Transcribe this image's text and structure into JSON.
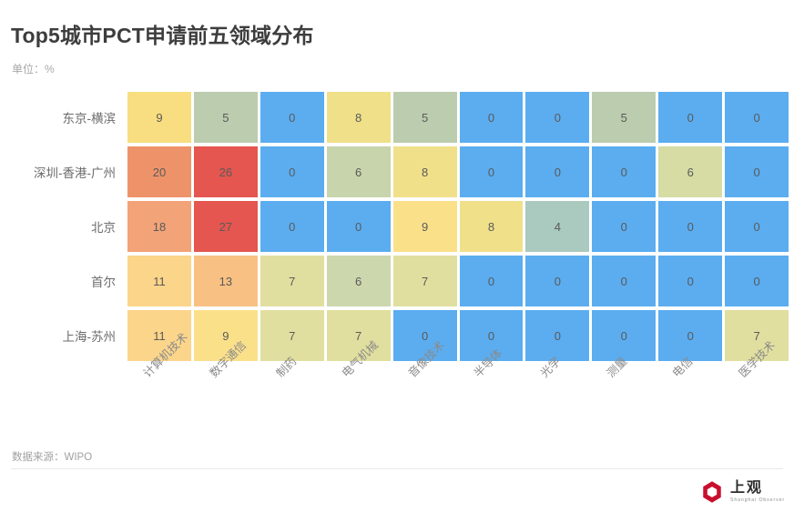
{
  "header": {
    "title": "Top5城市PCT申请前五领域分布",
    "subtitle": "单位：%"
  },
  "footer": {
    "source": "数据来源：WIPO",
    "logo_cn": "上观",
    "logo_en": "Shanghai Observer",
    "logo_color": "#C8102E"
  },
  "chart_data": {
    "type": "heatmap",
    "title": "Top5城市PCT申请前五领域分布",
    "subtitle": "单位：%",
    "xlabel": "",
    "ylabel": "",
    "unit": "%",
    "categories": [
      "计算机技术",
      "数字通信",
      "制药",
      "电气机械",
      "音像技术",
      "半导体",
      "光学",
      "测量",
      "电信",
      "医学技术"
    ],
    "rows": [
      "东京-横滨",
      "深圳-香港-广州",
      "北京",
      "首尔",
      "上海-苏州"
    ],
    "values": [
      [
        9,
        5,
        0,
        8,
        5,
        0,
        0,
        5,
        0,
        0
      ],
      [
        20,
        26,
        0,
        6,
        8,
        0,
        0,
        0,
        6,
        0
      ],
      [
        18,
        27,
        0,
        0,
        9,
        8,
        4,
        0,
        0,
        0
      ],
      [
        11,
        13,
        7,
        6,
        7,
        0,
        0,
        0,
        0,
        0
      ],
      [
        11,
        9,
        7,
        7,
        0,
        0,
        0,
        0,
        0,
        7
      ]
    ],
    "cell_colors": [
      [
        "#F8DE80",
        "#BCCCAF",
        "#5BADF0",
        "#F0E08A",
        "#BCCCAF",
        "#5BADF0",
        "#5BADF0",
        "#BCCCAF",
        "#5BADF0",
        "#5BADF0"
      ],
      [
        "#EE9369",
        "#E4564F",
        "#5BADF0",
        "#C8D4AB",
        "#F0E08A",
        "#5BADF0",
        "#5BADF0",
        "#5BADF0",
        "#D6DCA4",
        "#5BADF0"
      ],
      [
        "#F2A377",
        "#E4564F",
        "#5BADF0",
        "#5BADF0",
        "#FBE08A",
        "#F0E08A",
        "#AAC9BF",
        "#5BADF0",
        "#5BADF0",
        "#5BADF0"
      ],
      [
        "#FBD58A",
        "#F8C183",
        "#E1DF9F",
        "#CCD7AD",
        "#E1DF9F",
        "#5BADF0",
        "#5BADF0",
        "#5BADF0",
        "#5BADF0",
        "#5BADF0"
      ],
      [
        "#FBD58A",
        "#FBE08A",
        "#E1DF9F",
        "#E1DF9F",
        "#5BADF0",
        "#5BADF0",
        "#5BADF0",
        "#5BADF0",
        "#5BADF0",
        "#E1DF9F"
      ]
    ],
    "value_range": [
      0,
      27
    ],
    "grid": false,
    "legend": "none"
  }
}
